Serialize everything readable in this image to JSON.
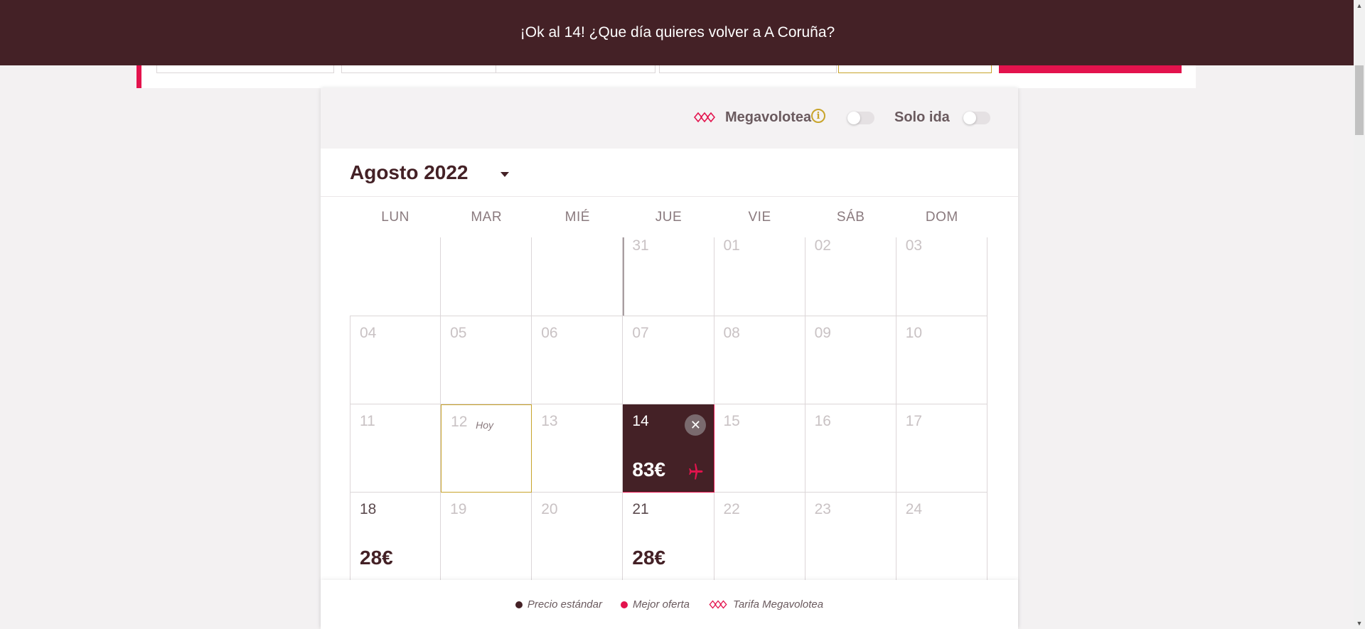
{
  "banner": {
    "message": "¡Ok al 14! ¿Que día quieres volver a A Coruña?"
  },
  "options": {
    "megavolotea_label": "Megavolotea",
    "megavolotea_on": false,
    "one_way_label": "Solo ida",
    "one_way_on": false
  },
  "calendar": {
    "month_label": "Agosto 2022",
    "weekdays": [
      "LUN",
      "MAR",
      "MIÉ",
      "JUE",
      "VIE",
      "SÁB",
      "DOM"
    ],
    "today_tag": "Hoy",
    "weeks": [
      [
        {
          "num": "",
          "price": ""
        },
        {
          "num": "",
          "price": ""
        },
        {
          "num": "",
          "price": ""
        },
        {
          "num": "31",
          "price": ""
        },
        {
          "num": "01",
          "price": ""
        },
        {
          "num": "02",
          "price": ""
        },
        {
          "num": "03",
          "price": ""
        }
      ],
      [
        {
          "num": "04",
          "price": ""
        },
        {
          "num": "05",
          "price": ""
        },
        {
          "num": "06",
          "price": ""
        },
        {
          "num": "07",
          "price": ""
        },
        {
          "num": "08",
          "price": ""
        },
        {
          "num": "09",
          "price": ""
        },
        {
          "num": "10",
          "price": ""
        }
      ],
      [
        {
          "num": "11",
          "price": ""
        },
        {
          "num": "12",
          "price": ""
        },
        {
          "num": "13",
          "price": ""
        },
        {
          "num": "14",
          "price": "83€"
        },
        {
          "num": "15",
          "price": ""
        },
        {
          "num": "16",
          "price": ""
        },
        {
          "num": "17",
          "price": ""
        }
      ],
      [
        {
          "num": "18",
          "price": "28€"
        },
        {
          "num": "19",
          "price": ""
        },
        {
          "num": "20",
          "price": ""
        },
        {
          "num": "21",
          "price": "28€"
        },
        {
          "num": "22",
          "price": ""
        },
        {
          "num": "23",
          "price": ""
        },
        {
          "num": "24",
          "price": ""
        }
      ]
    ]
  },
  "legend": {
    "standard_label": "Precio estándar",
    "best_label": "Mejor oferta",
    "mega_label": "Tarifa Megavolotea"
  },
  "colors": {
    "brand_dark": "#442126",
    "accent": "#e3134d",
    "today_border": "#c8a42b"
  }
}
